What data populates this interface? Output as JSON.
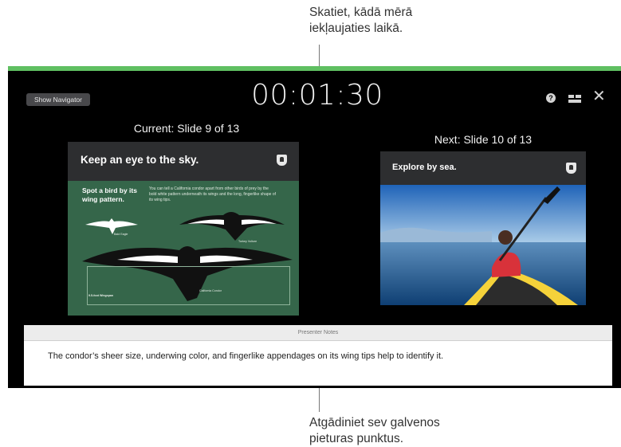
{
  "callouts": {
    "top_line1": "Skatiet, kādā mērā",
    "top_line2": "iekļaujaties laikā.",
    "bottom_line1": "Atgādiniet sev galvenos",
    "bottom_line2": "pieturas punktus."
  },
  "toolbar": {
    "navigator_label": "Show Navigator",
    "timer": "00:01:30",
    "help_icon": "?"
  },
  "current": {
    "label": "Current: Slide 9 of 13",
    "title": "Keep an eye to the sky.",
    "subtitle": "Spot a bird by its wing pattern.",
    "body": "You can tell a California condor apart from other birds of prey by the bold white pattern underneath its wings and the long, fingerlike shape of its wing tips.",
    "bird_label_1": "Bald Eagle",
    "bird_label_2": "Turkey Vulture",
    "wingspan_label": "9.5-foot Wingspan",
    "condor_label": "California Condor"
  },
  "next": {
    "label": "Next: Slide 10 of 13",
    "title": "Explore by sea."
  },
  "notes": {
    "header": "Presenter Notes",
    "text": "The condor’s sheer size, underwing color, and fingerlike appendages on its wing tips help to identify it."
  },
  "colors": {
    "accent_bar": "#5fbf61",
    "slide_green": "#35664a",
    "window_bg": "#000000"
  }
}
